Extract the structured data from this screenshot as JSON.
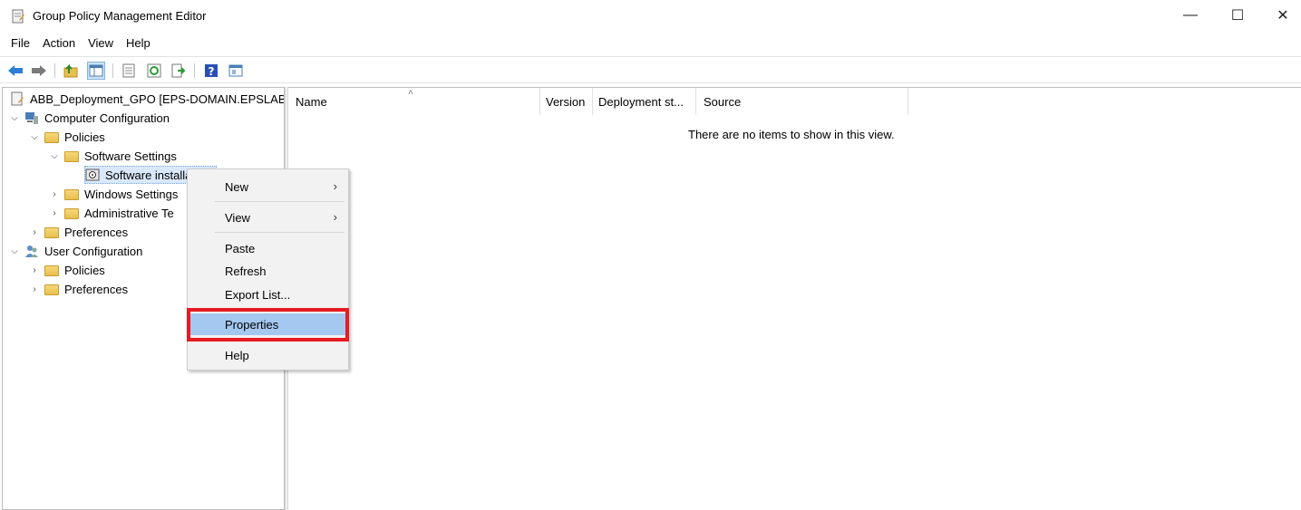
{
  "window": {
    "title": "Group Policy Management Editor",
    "minimize": "—",
    "maximize": "☐",
    "close": "✕"
  },
  "menu": [
    "File",
    "Action",
    "View",
    "Help"
  ],
  "tree": {
    "root": "ABB_Deployment_GPO [EPS-DOMAIN.EPSLAB",
    "computer_config": "Computer Configuration",
    "policies": "Policies",
    "software_settings": "Software Settings",
    "software_installation": "Software installation",
    "windows_settings": "Windows Settings",
    "administrative_templates": "Administrative Te",
    "preferences": "Preferences",
    "user_config": "User Configuration",
    "user_policies": "Policies",
    "user_preferences": "Preferences"
  },
  "list": {
    "columns": [
      "Name",
      "Version",
      "Deployment st...",
      "Source"
    ],
    "empty_message": "There are no items to show in this view."
  },
  "context_menu": {
    "new": "New",
    "view": "View",
    "paste": "Paste",
    "refresh": "Refresh",
    "export": "Export List...",
    "properties": "Properties",
    "help": "Help",
    "submenu_arrow": "›"
  },
  "colors": {
    "highlight": "#a4c8f0",
    "annotation_box": "#e61b23"
  },
  "icons": [
    "back-arrow-icon",
    "forward-arrow-icon",
    "up-folder-icon",
    "show-hide-tree-icon",
    "properties-icon",
    "refresh-icon",
    "export-icon",
    "help-icon",
    "console-icon"
  ]
}
